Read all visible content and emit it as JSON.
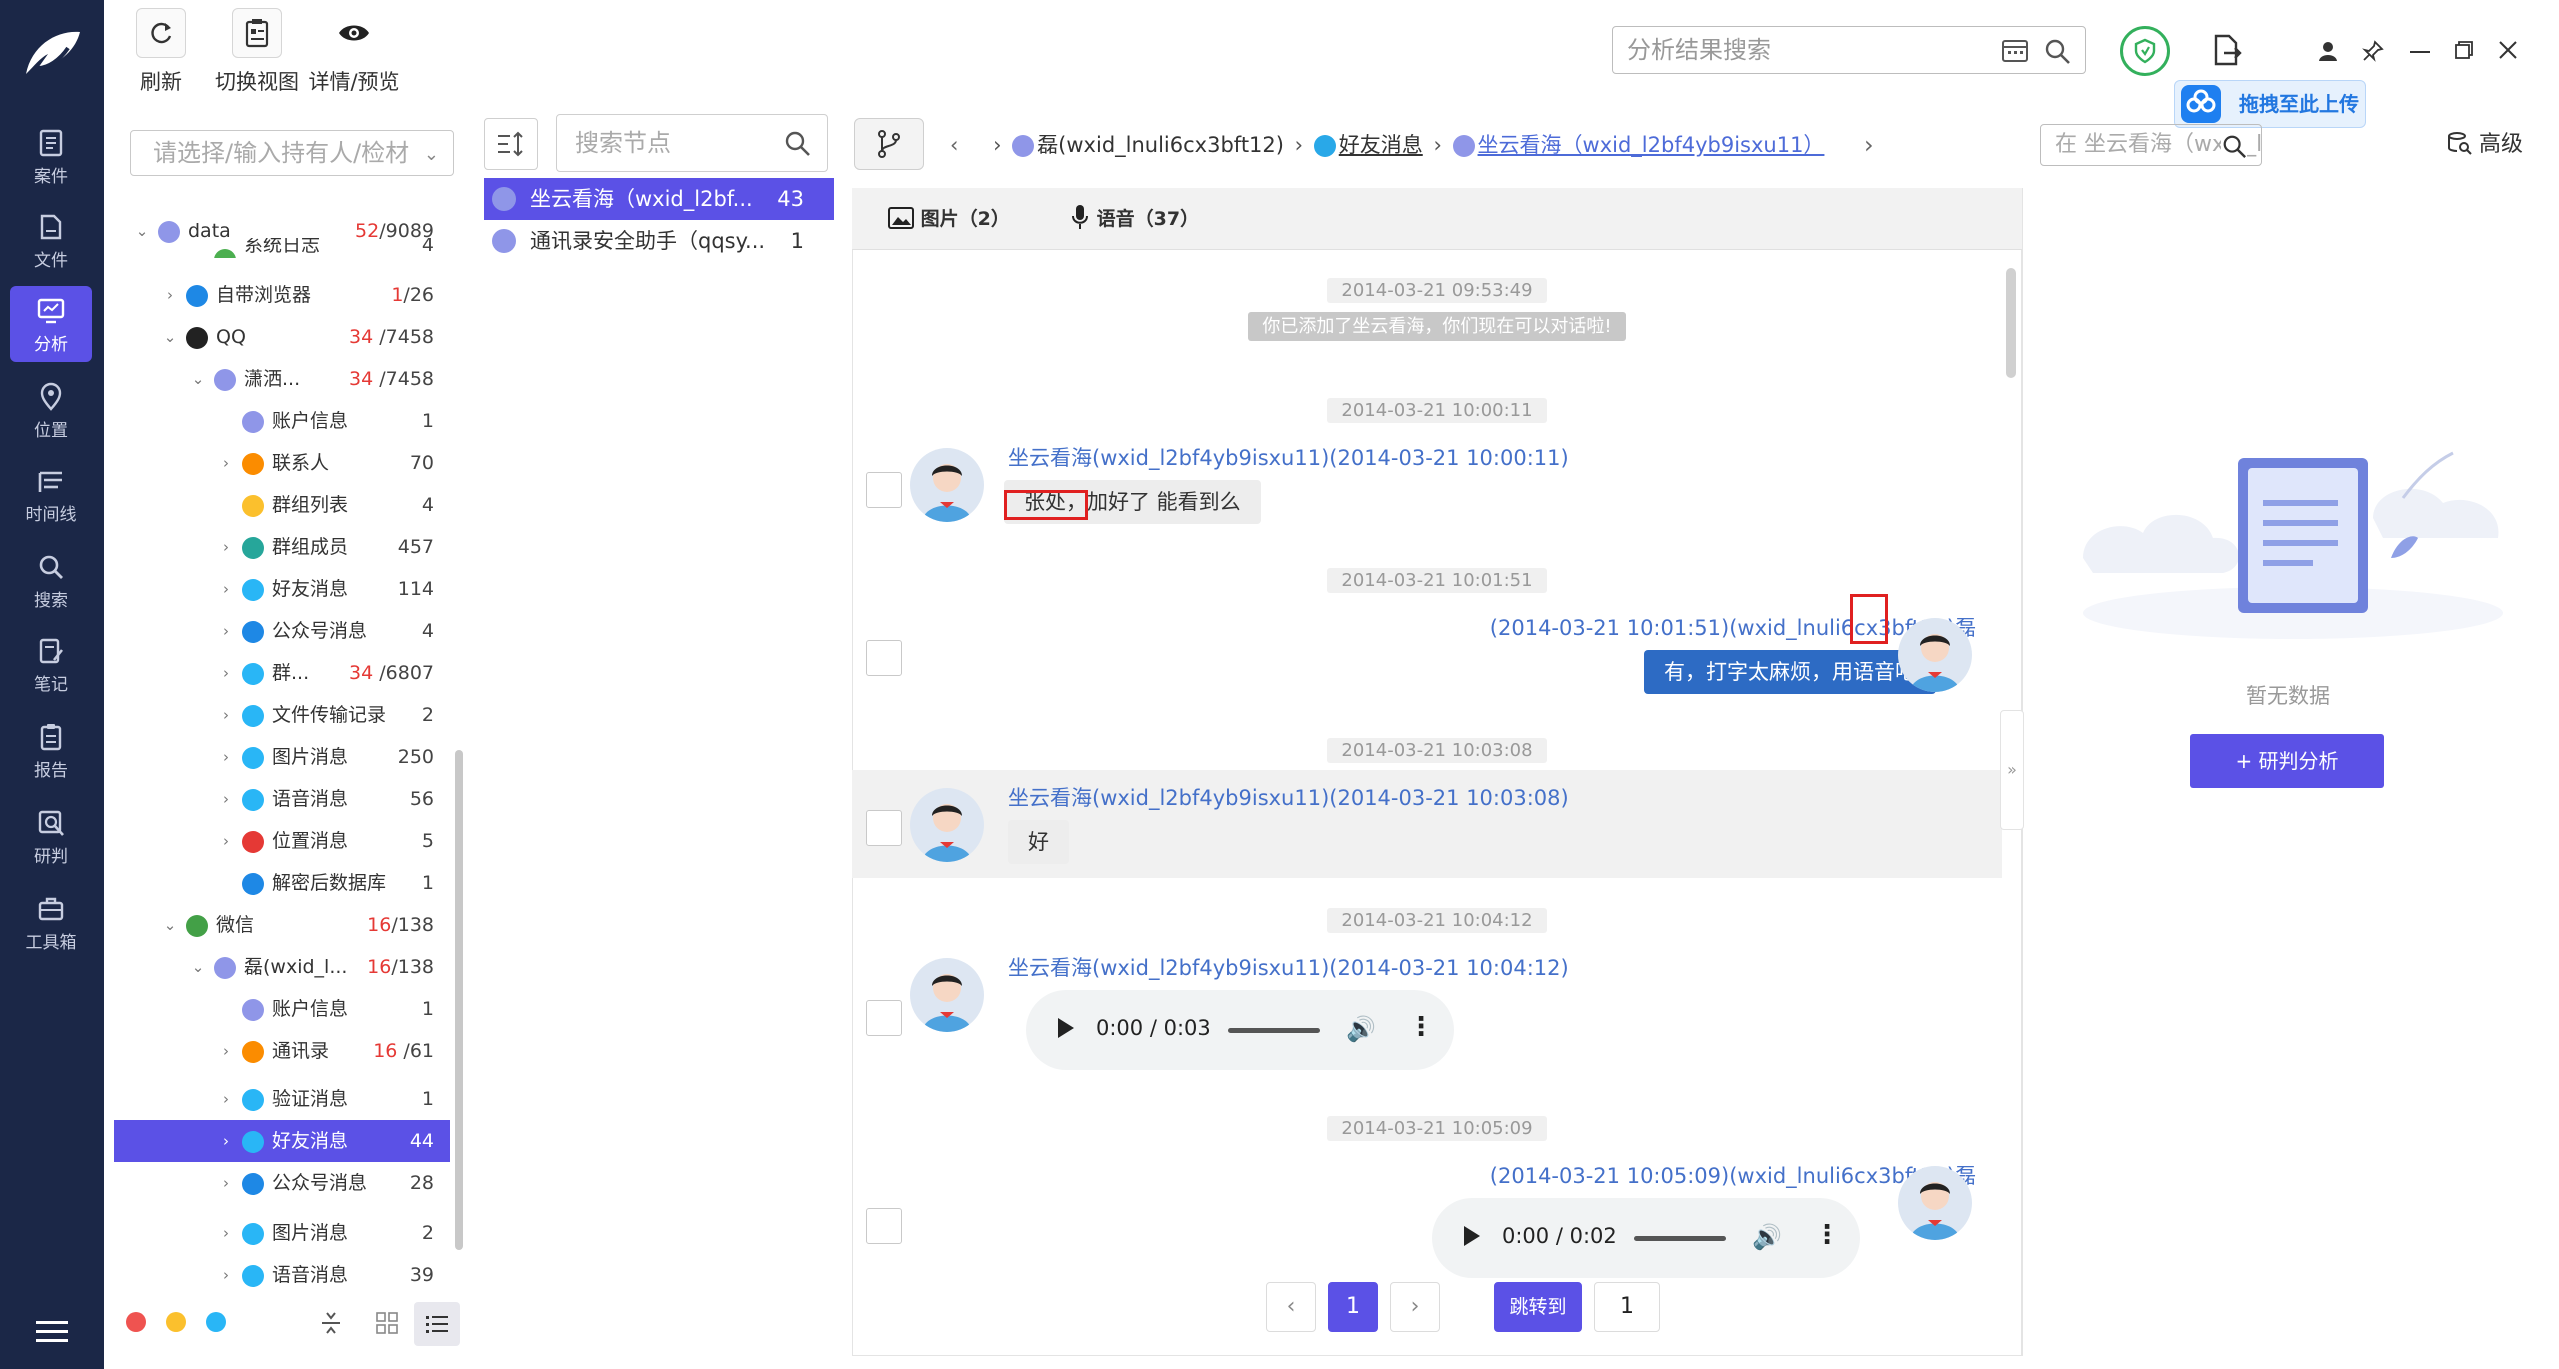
{
  "nav": {
    "items": [
      {
        "label": "案件",
        "icon": "case-icon"
      },
      {
        "label": "文件",
        "icon": "file-icon"
      },
      {
        "label": "分析",
        "icon": "analysis-icon",
        "active": true
      },
      {
        "label": "位置",
        "icon": "location-icon"
      },
      {
        "label": "时间线",
        "icon": "timeline-icon"
      },
      {
        "label": "搜索",
        "icon": "search-icon"
      },
      {
        "label": "笔记",
        "icon": "note-icon"
      },
      {
        "label": "报告",
        "icon": "report-icon"
      },
      {
        "label": "研判",
        "icon": "judge-icon"
      },
      {
        "label": "工具箱",
        "icon": "toolbox-icon"
      }
    ]
  },
  "toolbar": {
    "refresh": "刷新",
    "switch_view": "切换视图",
    "details": "详情/预览"
  },
  "top_right": {
    "search_placeholder": "分析结果搜索",
    "upload_tip": "拖拽至此上传"
  },
  "tree": {
    "search_placeholder": "请选择/输入持有人/检材",
    "rows": [
      {
        "label": "data",
        "count_red": "52",
        "count": "/9089"
      },
      {
        "label": "系统日志",
        "count_red": "",
        "count": "4"
      },
      {
        "label": "自带浏览器",
        "count_red": "1",
        "count": "/26"
      },
      {
        "label": "QQ",
        "count_red": "34",
        "count": " /7458"
      },
      {
        "label": "潇洒...",
        "count_red": "34",
        "count": " /7458"
      },
      {
        "label": "账户信息",
        "count_red": "",
        "count": "1"
      },
      {
        "label": "联系人",
        "count_red": "",
        "count": "70"
      },
      {
        "label": "群组列表",
        "count_red": "",
        "count": "4"
      },
      {
        "label": "群组成员",
        "count_red": "",
        "count": "457"
      },
      {
        "label": "好友消息",
        "count_red": "",
        "count": "114"
      },
      {
        "label": "公众号消息",
        "count_red": "",
        "count": "4"
      },
      {
        "label": "群...",
        "count_red": "34",
        "count": " /6807"
      },
      {
        "label": "文件传输记录",
        "count_red": "",
        "count": "2"
      },
      {
        "label": "图片消息",
        "count_red": "",
        "count": "250"
      },
      {
        "label": "语音消息",
        "count_red": "",
        "count": "56"
      },
      {
        "label": "位置消息",
        "count_red": "",
        "count": "5"
      },
      {
        "label": "解密后数据库",
        "count_red": "",
        "count": "1"
      },
      {
        "label": "微信",
        "count_red": "16",
        "count": "/138"
      },
      {
        "label": "磊(wxid_l...",
        "count_red": "16",
        "count": "/138"
      },
      {
        "label": "账户信息",
        "count_red": "",
        "count": "1"
      },
      {
        "label": "通讯录",
        "count_red": "16",
        "count": " /61"
      },
      {
        "label": "验证消息",
        "count_red": "",
        "count": "1"
      },
      {
        "label": "好友消息",
        "count_red": "",
        "count": "44"
      },
      {
        "label": "公众号消息",
        "count_red": "",
        "count": "28"
      },
      {
        "label": "图片消息",
        "count_red": "",
        "count": "2"
      },
      {
        "label": "语音消息",
        "count_red": "",
        "count": "39"
      }
    ]
  },
  "middle": {
    "search_placeholder": "搜索节点",
    "items": [
      {
        "name": "坐云看海（wxid_l2bf...",
        "count": "43"
      },
      {
        "name": "通讯录安全助手（qqsy...",
        "count": "1"
      }
    ]
  },
  "breadcrumb": {
    "user": "磊(wxid_lnuli6cx3bft12)",
    "category": "好友消息",
    "contact": "坐云看海（wxid_l2bf4yb9isxu11）"
  },
  "chat_search_placeholder": "在 坐云看海（wxid_l2bf4",
  "advanced": "高级",
  "tabs": [
    {
      "label": "图片（2）"
    },
    {
      "label": "语音（37）"
    }
  ],
  "messages": {
    "ts1": "2014-03-21 09:53:49",
    "sys1": "你已添加了坐云看海，你们现在可以对话啦!",
    "ts2": "2014-03-21 10:00:11",
    "m1_sender": "坐云看海(wxid_l2bf4yb9isxu11)(2014-03-21 10:00:11)",
    "m1_text": "张处，加好了 能看到么",
    "ts3": "2014-03-21 10:01:51",
    "m2_sender": "(2014-03-21 10:01:51)(wxid_lnuli6cx3bft12)磊",
    "m2_text": "有，打字太麻烦，用语音吧",
    "ts4": "2014-03-21 10:03:08",
    "m3_sender": "坐云看海(wxid_l2bf4yb9isxu11)(2014-03-21 10:03:08)",
    "m3_text": "好",
    "ts5": "2014-03-21 10:04:12",
    "m4_sender": "坐云看海(wxid_l2bf4yb9isxu11)(2014-03-21 10:04:12)",
    "m4_audio": "0:00 / 0:03",
    "ts6": "2014-03-21 10:05:09",
    "m5_sender": "(2014-03-21 10:05:09)(wxid_lnuli6cx3bft12)磊",
    "m5_audio": "0:00 / 0:02"
  },
  "pagination": {
    "current": "1",
    "jump_label": "跳转到",
    "jump_value": "1"
  },
  "right_panel": {
    "empty_text": "暂无数据",
    "analyze_button": "+ 研判分析"
  },
  "colors": {
    "accent": "#5b51e6",
    "nav_bg": "#1b2747",
    "bubble_right": "#2d6bc4",
    "link": "#4470c9",
    "count_red": "#e53935"
  }
}
